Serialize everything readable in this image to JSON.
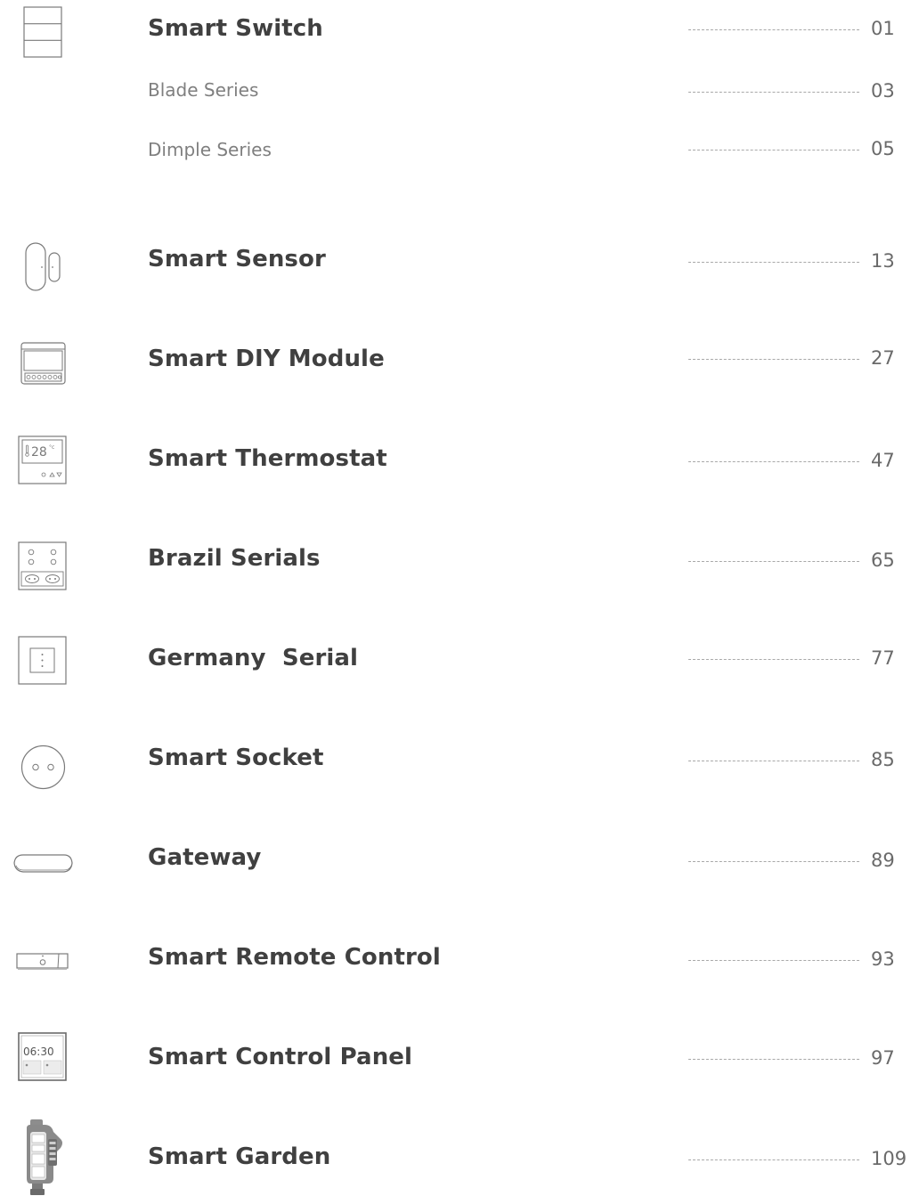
{
  "toc": {
    "entries": [
      {
        "title": "Smart Switch",
        "page": "01",
        "icon": "wall-switch-icon"
      },
      {
        "title": "Blade Series",
        "page": "03"
      },
      {
        "title": "Dimple Series",
        "page": "05"
      },
      {
        "title": "Smart Sensor",
        "page": "13",
        "icon": "door-sensor-icon"
      },
      {
        "title": "Smart DIY Module",
        "page": "27",
        "icon": "diy-module-icon"
      },
      {
        "title": "Smart Thermostat",
        "page": "47",
        "icon": "thermostat-icon",
        "display": "28",
        "unit": "°c"
      },
      {
        "title": "Brazil Serials",
        "page": "65",
        "icon": "brazil-socket-panel-icon"
      },
      {
        "title": "Germany  Serial",
        "page": "77",
        "icon": "germany-panel-icon"
      },
      {
        "title": "Smart Socket",
        "page": "85",
        "icon": "round-socket-icon"
      },
      {
        "title": "Gateway",
        "page": "89",
        "icon": "gateway-icon"
      },
      {
        "title": "Smart Remote Control",
        "page": "93",
        "icon": "ir-remote-icon"
      },
      {
        "title": "Smart Control Panel",
        "page": "97",
        "icon": "control-panel-icon",
        "display": "06:30"
      },
      {
        "title": "Smart Garden",
        "page": "109",
        "icon": "garden-timer-icon"
      }
    ]
  },
  "colors": {
    "title": "#404040",
    "subtitle": "#7f7f7f",
    "page_number": "#6a6a6a",
    "leader": "#a8a8a8",
    "icon_stroke": "#7a7a7a"
  }
}
